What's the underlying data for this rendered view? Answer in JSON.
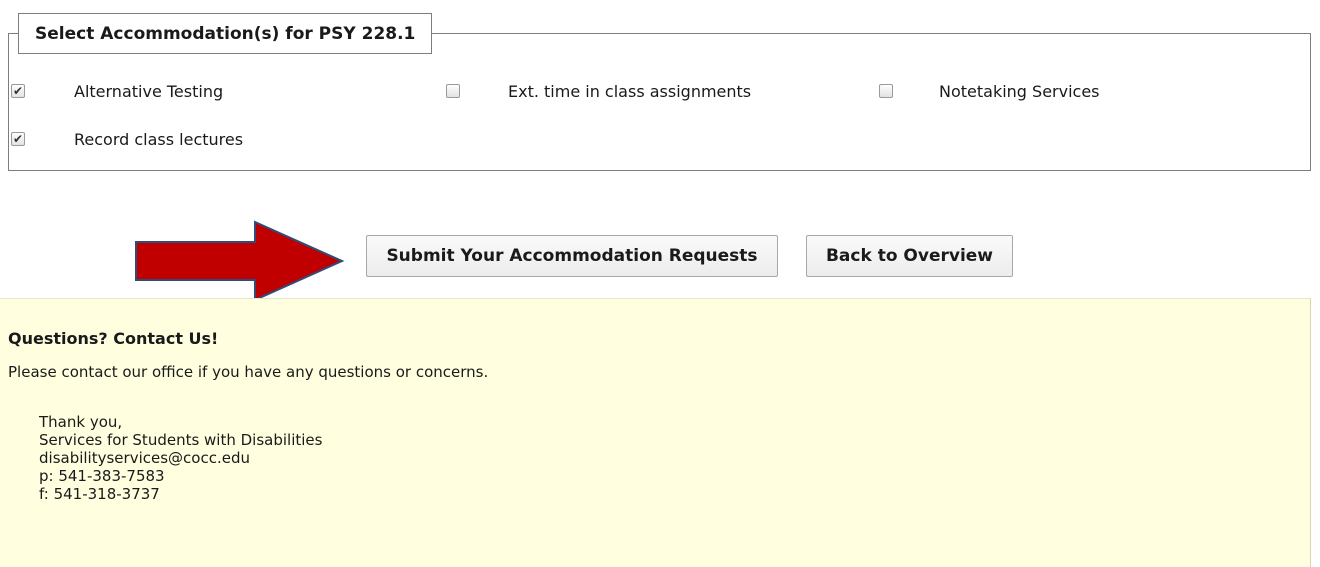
{
  "accommodations": {
    "legend": "Select Accommodation(s) for PSY 228.1",
    "options": [
      {
        "label": "Alternative Testing",
        "checked": true
      },
      {
        "label": "Ext. time in class assignments",
        "checked": false
      },
      {
        "label": "Notetaking Services",
        "checked": false
      },
      {
        "label": "Record class lectures",
        "checked": true
      }
    ]
  },
  "actions": {
    "submit_label": "Submit Your Accommodation Requests",
    "back_label": "Back to Overview"
  },
  "contact": {
    "title": "Questions? Contact Us!",
    "message": "Please contact our office if you have any questions or concerns.",
    "signature": {
      "closing": "Thank you,",
      "office": "Services for Students with Disabilities",
      "email": "disabilityservices@cocc.edu",
      "phone": "p: 541-383-7583",
      "fax": "f: 541-318-3737"
    }
  },
  "colors": {
    "arrow_fill": "#c00000",
    "arrow_stroke": "#2f4d7a",
    "panel_background": "#ffffe0"
  }
}
